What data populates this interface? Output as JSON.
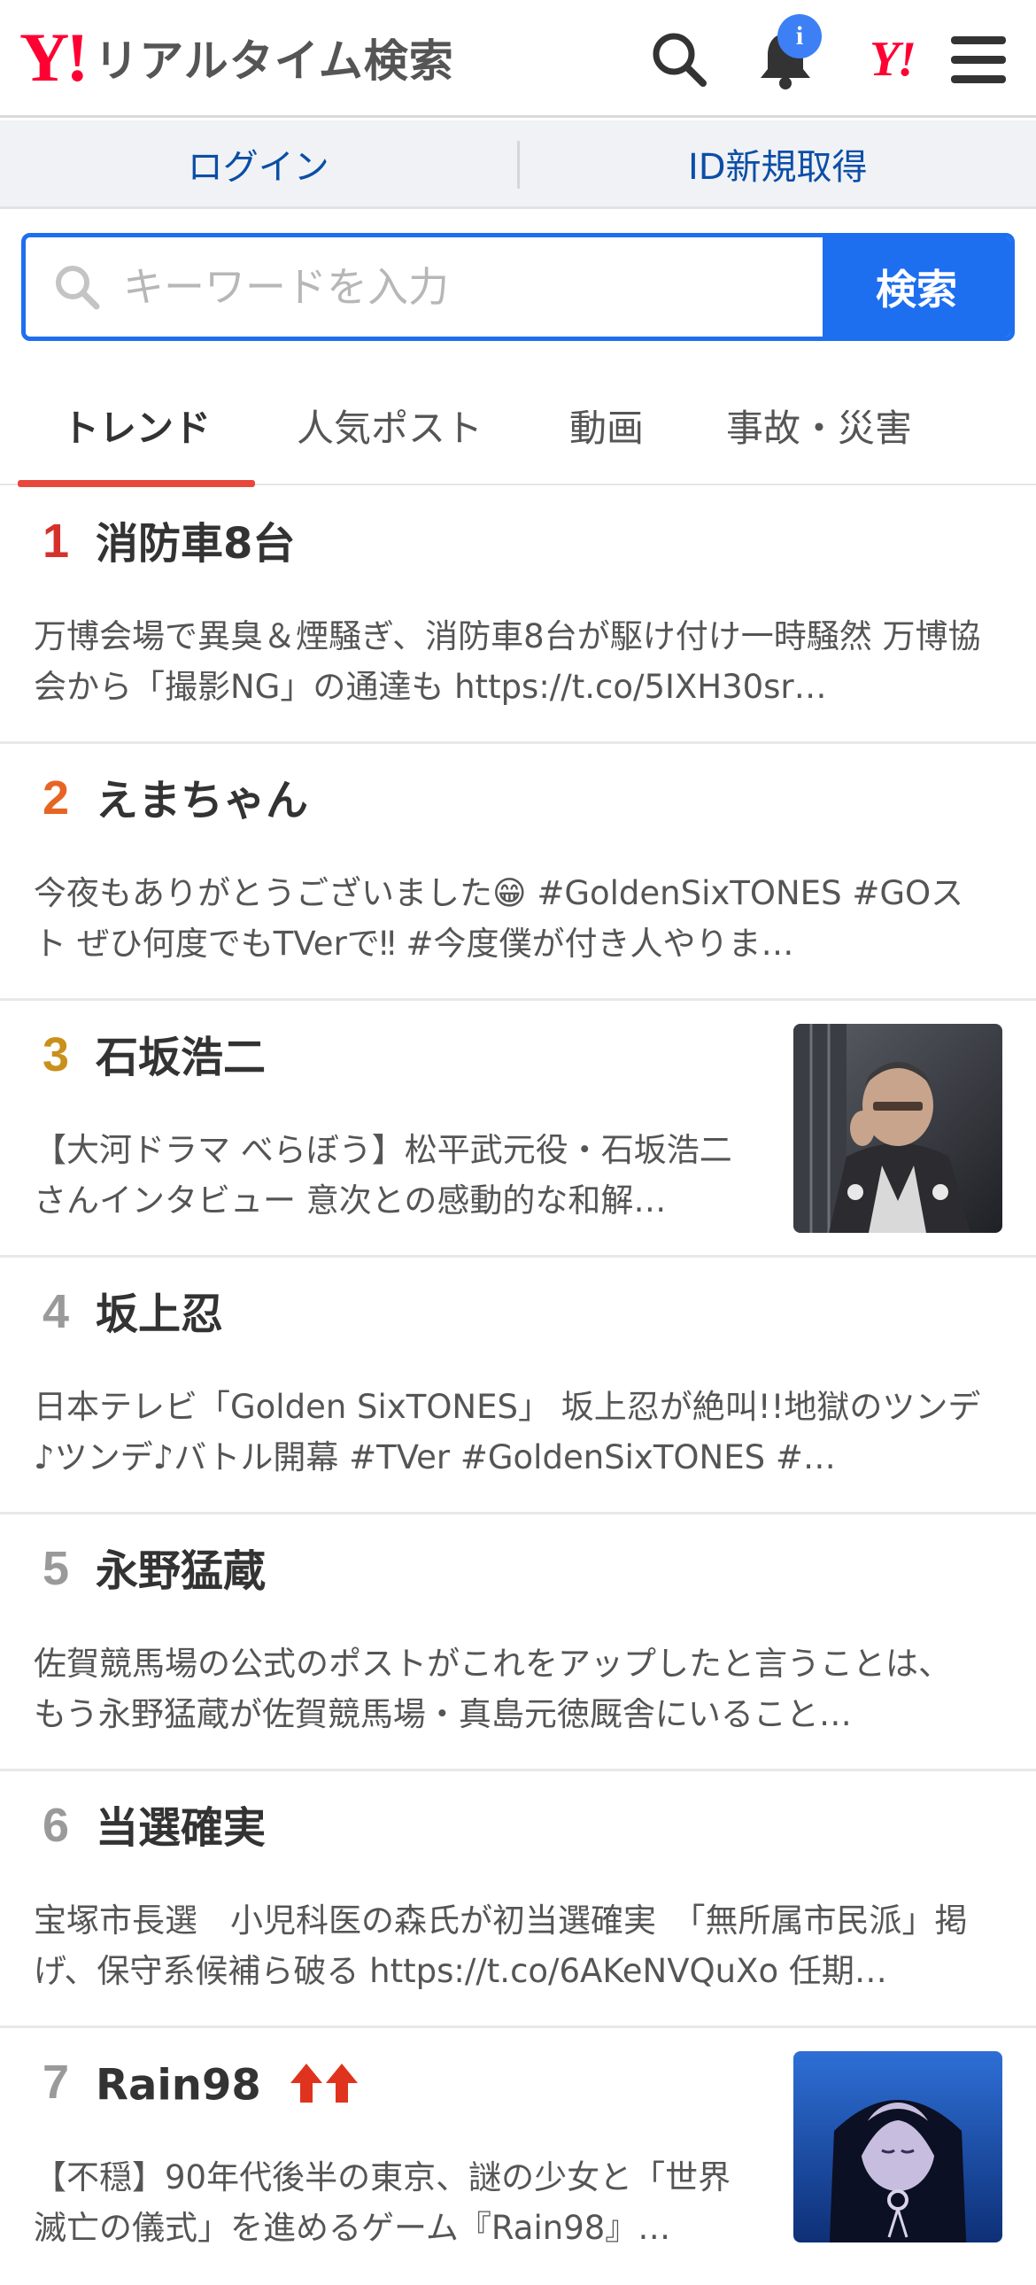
{
  "header": {
    "logo_mark": "Y!",
    "title": "リアルタイム検索",
    "notification_badge": "i",
    "yjapan_mark": "Y!"
  },
  "login_bar": {
    "login": "ログイン",
    "register": "ID新規取得"
  },
  "search": {
    "placeholder": "キーワードを入力",
    "button": "検索"
  },
  "tabs": [
    {
      "label": "トレンド",
      "active": true
    },
    {
      "label": "人気ポスト",
      "active": false
    },
    {
      "label": "動画",
      "active": false
    },
    {
      "label": "事故・災害",
      "active": false
    }
  ],
  "colors": {
    "rank1": "#d5322b",
    "rank2": "#e86424",
    "rank3": "#c9901b",
    "rank_other": "#9a9a9a",
    "accent_blue": "#1e6ff0",
    "trend_up": "#e0331e"
  },
  "trends": [
    {
      "rank": "1",
      "keyword": "消防車8台",
      "description": "万博会場で異臭＆煙騒ぎ、消防車8台が駆け付け一時騒然 万博協会から「撮影NG」の通達も https://t.co/5IXH30sr…",
      "thumbnail": null
    },
    {
      "rank": "2",
      "keyword": "えまちゃん",
      "description": "今夜もありがとうございました😁 #GoldenSixTONES #GOスト ぜひ何度でもTVerで‼ #今度僕が付き人やりま…",
      "thumbnail": null
    },
    {
      "rank": "3",
      "keyword": "石坂浩二",
      "description": "【大河ドラマ べらぼう】松平武元役・石坂浩二さんインタビュー 意次との感動的な和解…",
      "thumbnail": "samurai-portrait"
    },
    {
      "rank": "4",
      "keyword": "坂上忍",
      "description": "日本テレビ「Golden SixTONES」 坂上忍が絶叫!!地獄のツンデ♪ツンデ♪バトル開幕 #TVer #GoldenSixTONES #…",
      "thumbnail": null
    },
    {
      "rank": "5",
      "keyword": "永野猛蔵",
      "description": "佐賀競馬場の公式のポストがこれをアップしたと言うことは、もう永野猛蔵が佐賀競馬場・真島元徳厩舎にいること…",
      "thumbnail": null
    },
    {
      "rank": "6",
      "keyword": "当選確実",
      "description": "宝塚市長選　小児科医の森氏が初当選確実　「無所属市民派」掲げ、保守系候補ら破る https://t.co/6AKeNVQuXo 任期…",
      "thumbnail": null
    },
    {
      "rank": "7",
      "keyword": "Rain98",
      "description": "【不穏】90年代後半の東京、謎の少女と「世界滅亡の儀式」を進めるゲーム『Rain98』…",
      "thumbnail": "anime-girl",
      "trend_icon": "double-up-arrow-icon"
    }
  ]
}
